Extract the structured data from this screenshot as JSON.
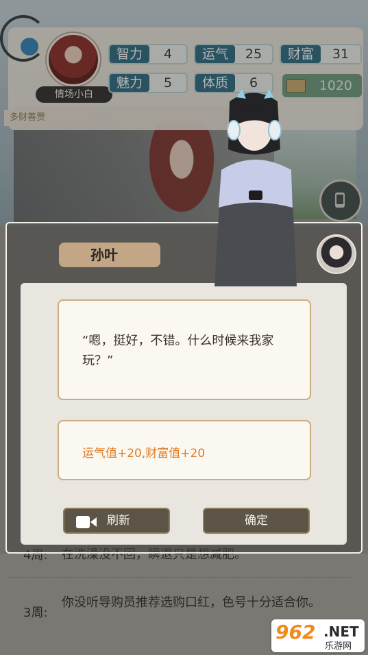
{
  "stats_panel": {
    "player_name": "情场小白",
    "stats": [
      {
        "label": "智力",
        "value": "4"
      },
      {
        "label": "运气",
        "value": "25"
      },
      {
        "label": "财富",
        "value": "31"
      },
      {
        "label": "魅力",
        "value": "5"
      },
      {
        "label": "体质",
        "value": "6"
      }
    ],
    "money": "1020",
    "rich_tag": "多财善贾"
  },
  "background_log": {
    "rows": [
      {
        "week": "4周:",
        "text": "在洗澡没不回，瞬退只是想减肥。"
      },
      {
        "week": "3周:",
        "text": "你没听导购员推荐选购口红，色号十分适合你。"
      }
    ]
  },
  "dialog": {
    "speaker": "孙叶",
    "quote": "“嗯，挺好，不错。什么时候来我家玩？”",
    "reward": "运气值+20,财富值+20",
    "refresh_label": "刷新",
    "confirm_label": "确定"
  },
  "watermark": {
    "brand": "962",
    "suffix": ".NET",
    "subtitle": "乐游网"
  },
  "colors": {
    "stat_label_bg": "#2b6a80",
    "reward_text": "#e07b23",
    "button_bg": "#5c5447",
    "box_border": "#c8ad7e"
  }
}
